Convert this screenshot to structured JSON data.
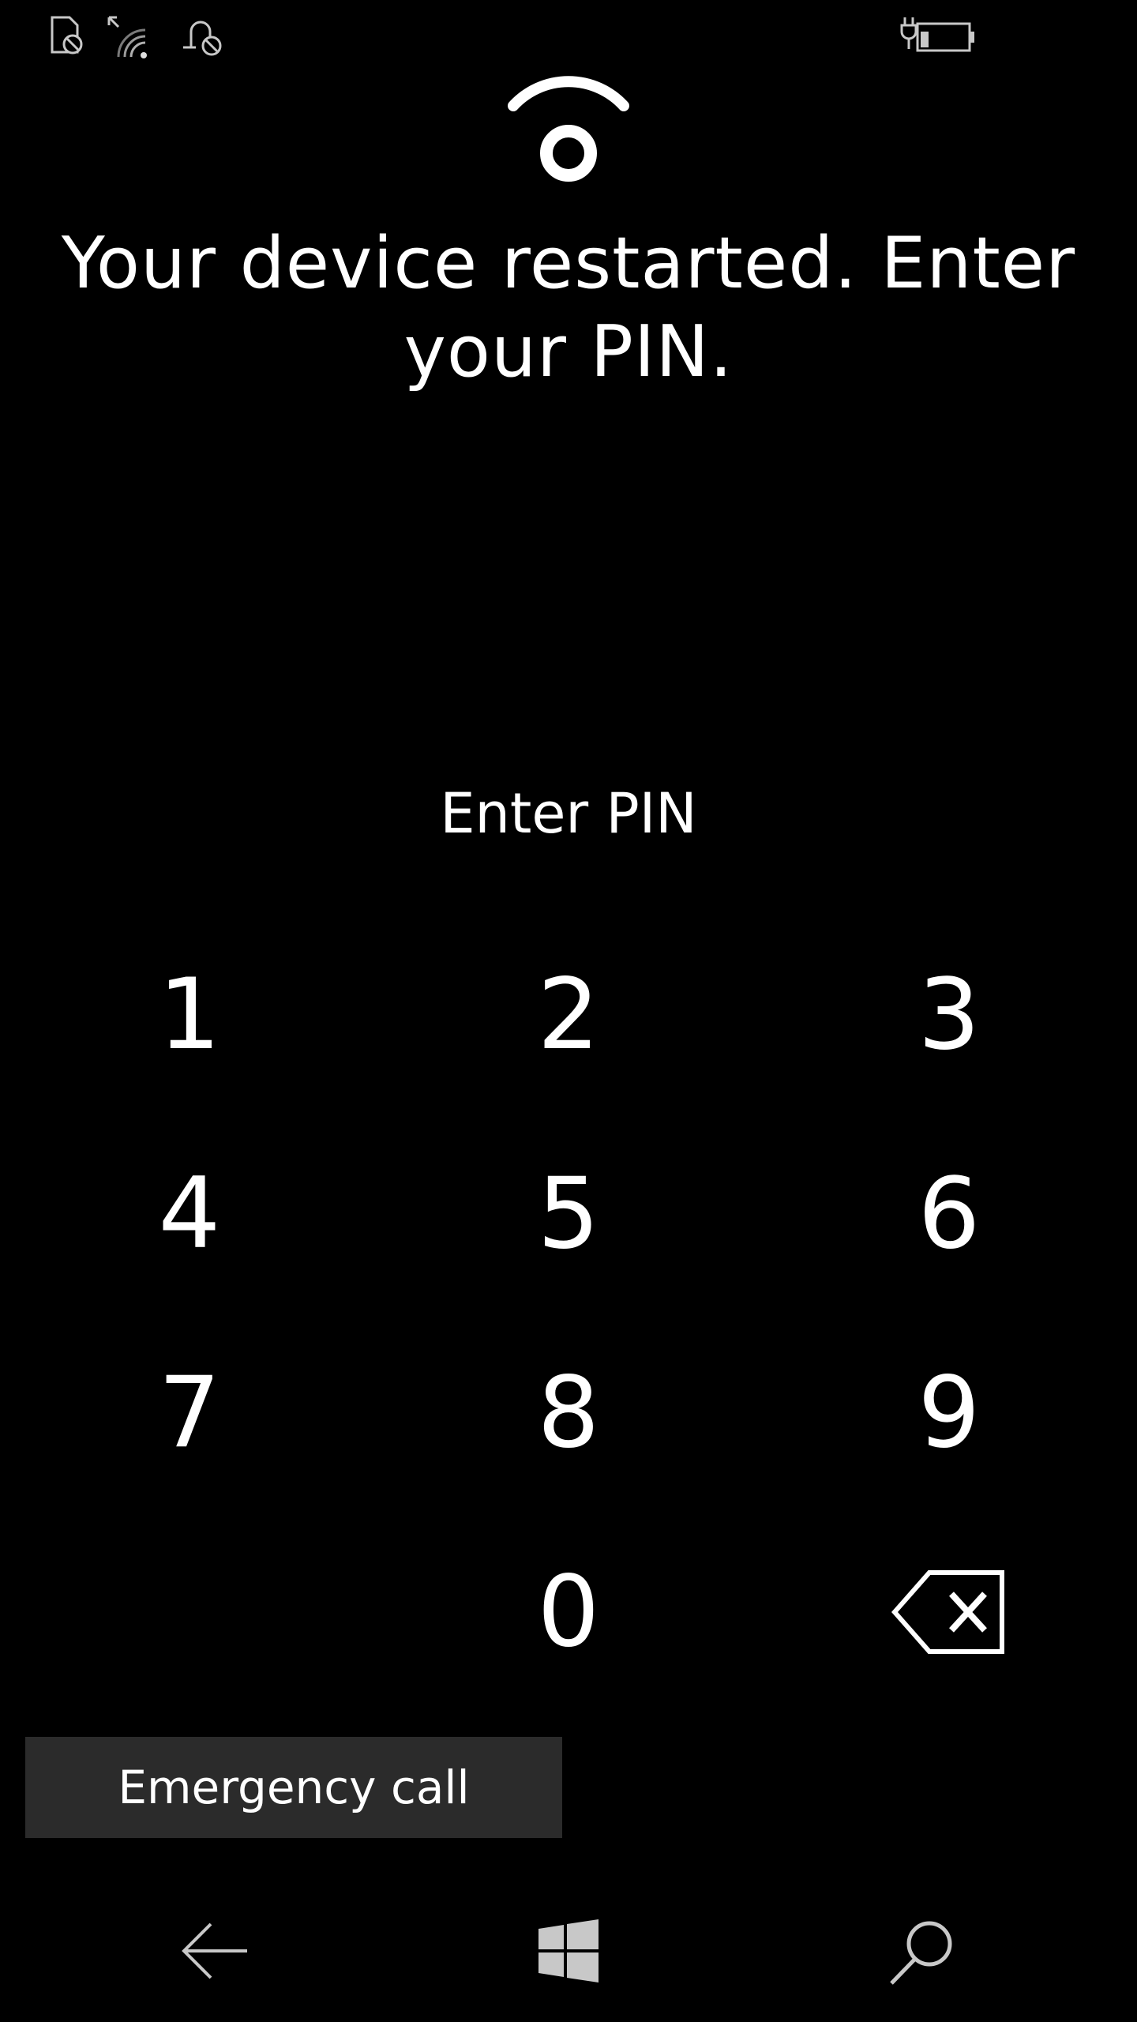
{
  "status_bar": {
    "icons": [
      "sim-blocked-icon",
      "wifi-signal-icon",
      "alarm-off-icon",
      "battery-charging-icon"
    ]
  },
  "lock": {
    "icon": "lock-status-icon",
    "message": "Your device restarted. Enter your PIN."
  },
  "pin": {
    "prompt": "Enter PIN"
  },
  "keypad": {
    "keys": [
      "1",
      "2",
      "3",
      "4",
      "5",
      "6",
      "7",
      "8",
      "9",
      "0"
    ],
    "backspace_icon": "backspace-icon"
  },
  "emergency": {
    "label": "Emergency call"
  },
  "nav": {
    "icons": [
      "back-arrow-icon",
      "windows-start-icon",
      "search-icon"
    ]
  },
  "colors": {
    "background": "#000000",
    "foreground": "#ffffff",
    "button_background": "#2b2b2b",
    "status_icon": "#bfbfbf"
  }
}
